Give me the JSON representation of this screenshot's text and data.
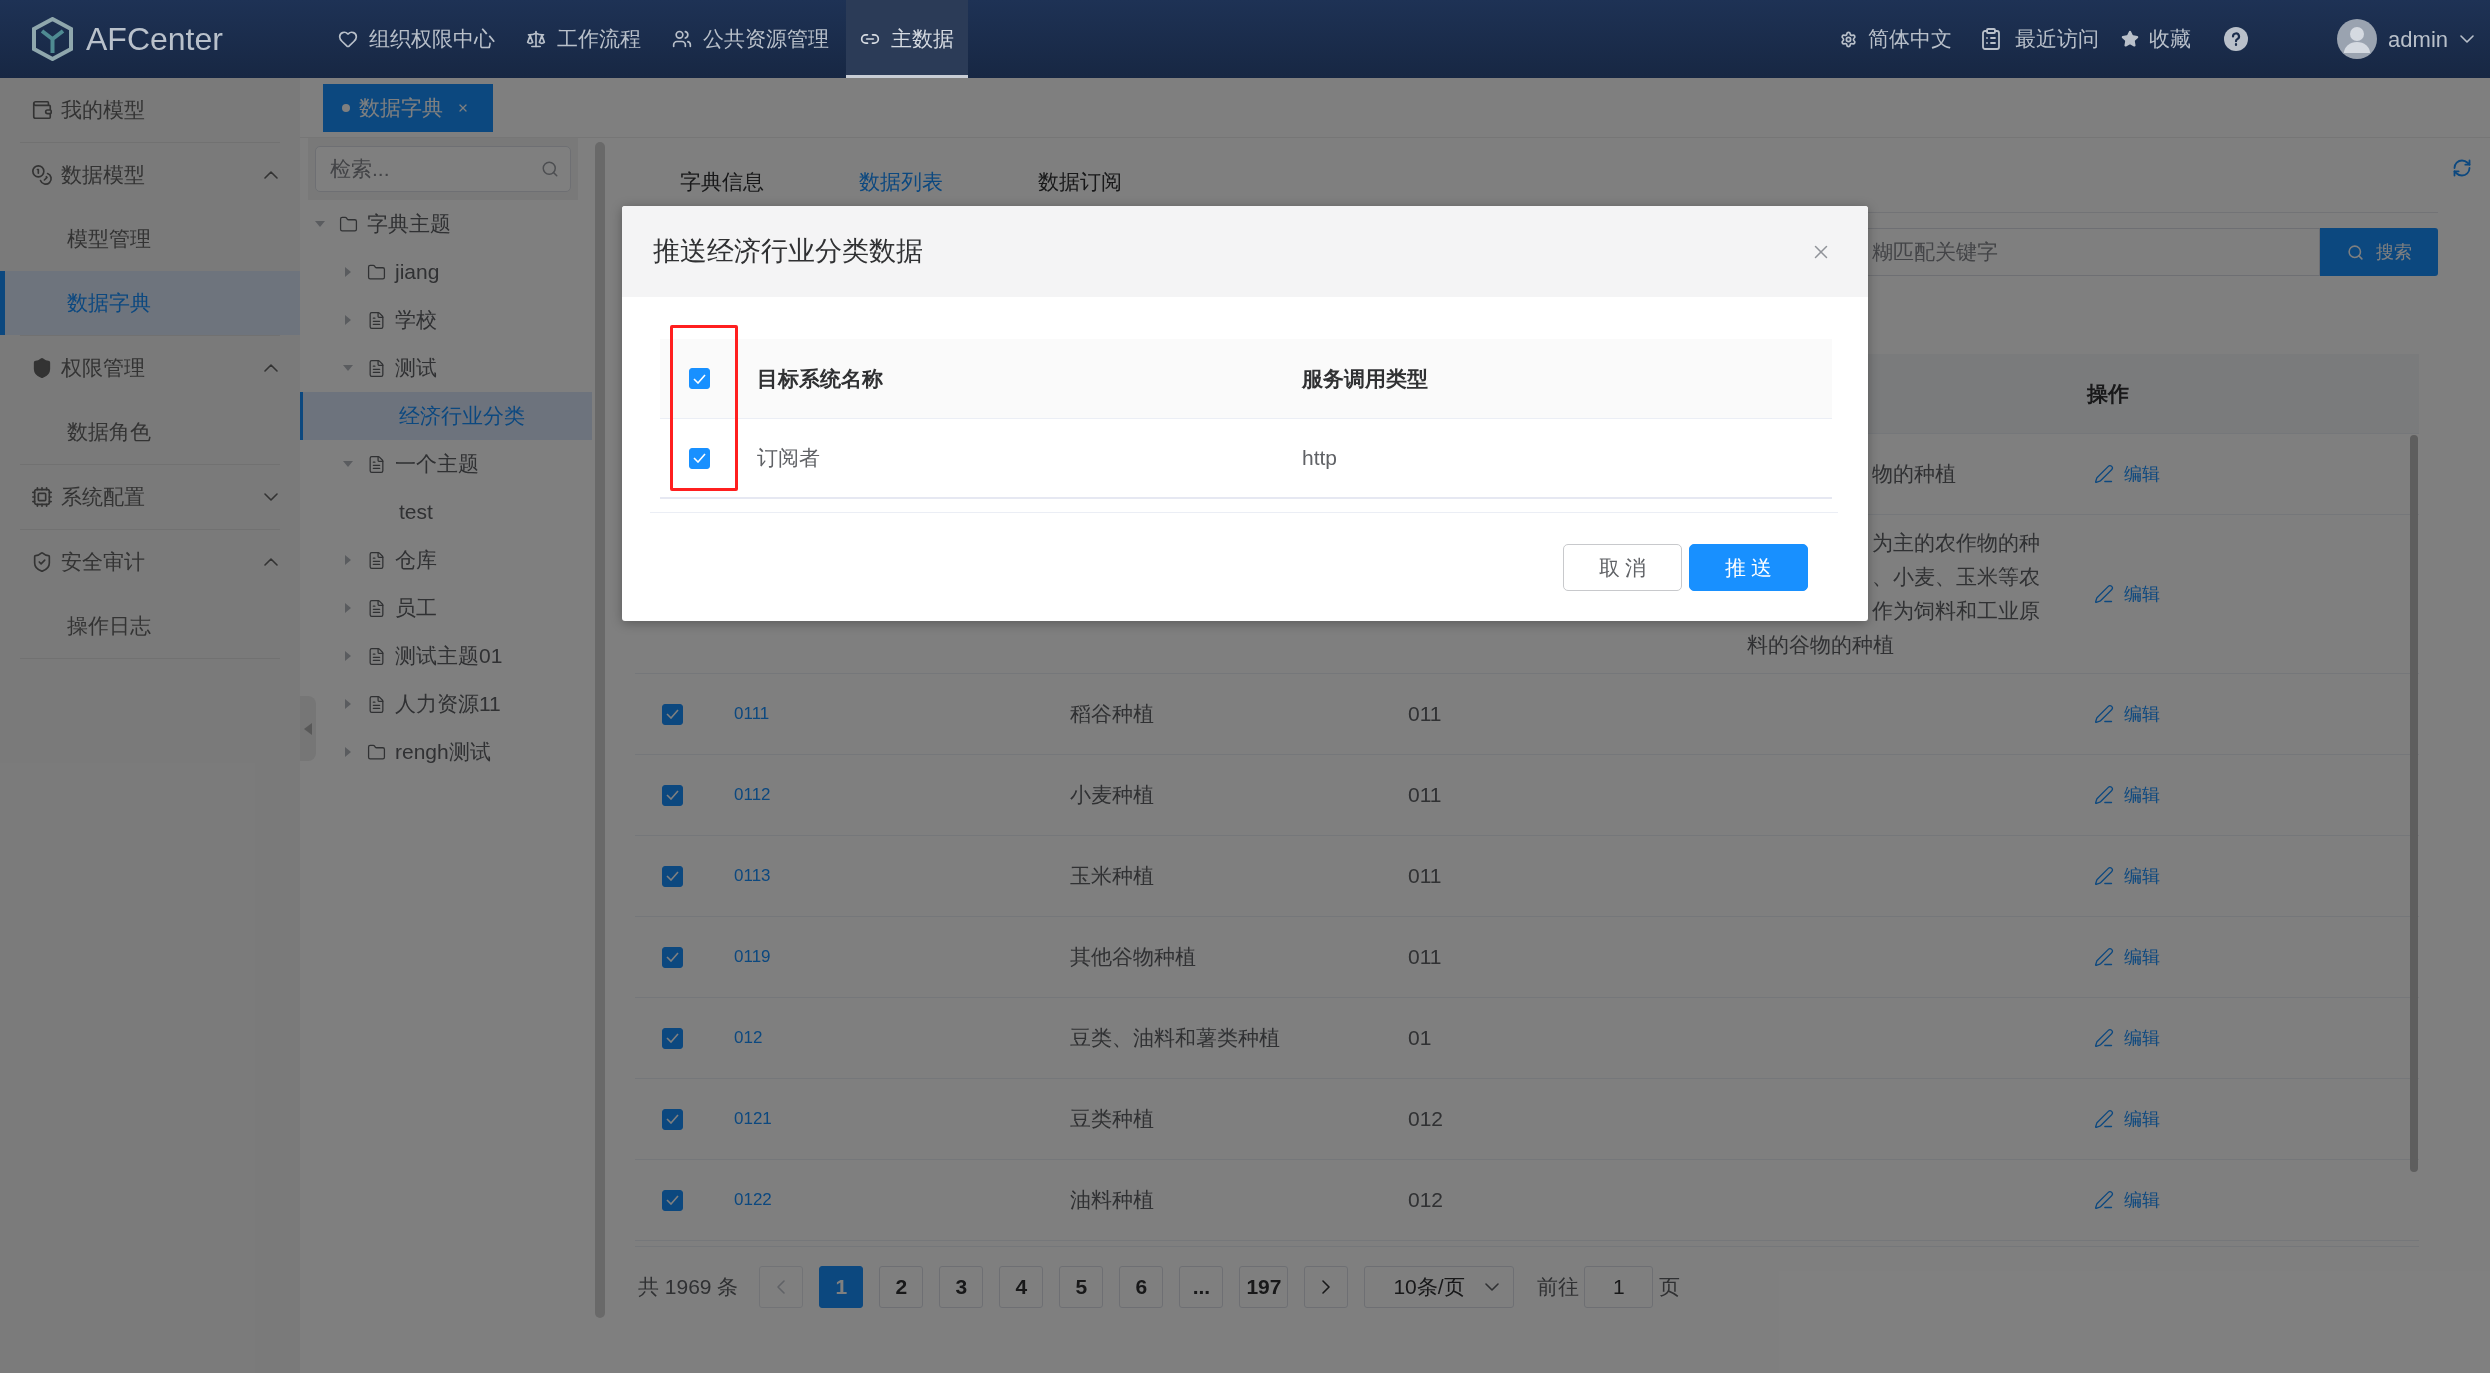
{
  "header": {
    "logo": "AFCenter",
    "nav": [
      {
        "label": "组织权限中心",
        "selected": false
      },
      {
        "label": "工作流程",
        "selected": false
      },
      {
        "label": "公共资源管理",
        "selected": false
      },
      {
        "label": "主数据",
        "selected": true
      }
    ],
    "language": "简体中文",
    "recent": "最近访问",
    "favorites": "收藏",
    "user": "admin"
  },
  "sidebar": {
    "items": [
      {
        "label": "我的模型",
        "selected": false
      },
      {
        "label": "数据模型",
        "expanded": true,
        "children": [
          {
            "label": "模型管理",
            "selected": false
          },
          {
            "label": "数据字典",
            "selected": true
          }
        ]
      },
      {
        "label": "权限管理",
        "expanded": true,
        "children": [
          {
            "label": "数据角色",
            "selected": false
          }
        ]
      },
      {
        "label": "系统配置",
        "expanded": false
      },
      {
        "label": "安全审计",
        "expanded": true,
        "children": [
          {
            "label": "操作日志",
            "selected": false
          }
        ]
      }
    ]
  },
  "tag_bar": {
    "tags": [
      {
        "label": "数据字典",
        "selected": true
      }
    ]
  },
  "tree": {
    "search": {
      "placeholder": "检索..."
    },
    "nodes": [
      {
        "label": "字典主题",
        "kind": "folder",
        "expanded": true,
        "selected": false,
        "children": [
          {
            "label": "jiang",
            "kind": "folder",
            "expanded": false,
            "selected": false
          },
          {
            "label": "学校",
            "kind": "file",
            "expanded": false,
            "selected": false
          },
          {
            "label": "测试",
            "kind": "file",
            "expanded": true,
            "selected": false,
            "children": [
              {
                "label": "经济行业分类",
                "selected": true
              }
            ]
          },
          {
            "label": "一个主题",
            "kind": "file",
            "expanded": true,
            "selected": false,
            "children": [
              {
                "label": "test",
                "selected": false
              }
            ]
          },
          {
            "label": "仓库",
            "kind": "file",
            "expanded": false,
            "selected": false
          },
          {
            "label": "员工",
            "kind": "file",
            "expanded": false,
            "selected": false
          },
          {
            "label": "测试主题01",
            "kind": "file",
            "expanded": false,
            "selected": false
          },
          {
            "label": "人力资源11",
            "kind": "file",
            "expanded": false,
            "selected": false
          },
          {
            "label": "rengh测试",
            "kind": "folder",
            "expanded": false,
            "selected": false
          }
        ]
      }
    ]
  },
  "tabs": [
    {
      "label": "字典信息",
      "selected": false
    },
    {
      "label": "数据列表",
      "selected": true
    },
    {
      "label": "数据订阅",
      "selected": false
    }
  ],
  "search": {
    "placeholder": "糊匹配关键字",
    "button": "搜索"
  },
  "table": {
    "operation_header": "操作",
    "rows": [
      {
        "column_5": [
          "物的种植"
        ],
        "operation": "编辑"
      },
      {
        "column_5": [
          "为主的农作物的种",
          "、小麦、玉米等农",
          "作为饲料和工业原",
          "料的谷物的种植"
        ],
        "operation": "编辑"
      },
      {
        "checked": true,
        "column_2": "0111",
        "column_3": "稻谷种植",
        "column_4": "011",
        "operation": "编辑"
      },
      {
        "checked": true,
        "column_2": "0112",
        "column_3": "小麦种植",
        "column_4": "011",
        "operation": "编辑"
      },
      {
        "checked": true,
        "column_2": "0113",
        "column_3": "玉米种植",
        "column_4": "011",
        "operation": "编辑"
      },
      {
        "checked": true,
        "column_2": "0119",
        "column_3": "其他谷物种植",
        "column_4": "011",
        "operation": "编辑"
      },
      {
        "checked": true,
        "column_2": "012",
        "column_3": "豆类、油料和薯类种植",
        "column_4": "01",
        "operation": "编辑"
      },
      {
        "checked": true,
        "column_2": "0121",
        "column_3": "豆类种植",
        "column_4": "012",
        "operation": "编辑"
      },
      {
        "checked": true,
        "column_2": "0122",
        "column_3": "油料种植",
        "column_4": "012",
        "operation": "编辑"
      }
    ]
  },
  "pagination": {
    "total": "共 1969 条",
    "prev_disabled": true,
    "next_disabled": false,
    "pages": [
      {
        "label": "1",
        "selected": true
      },
      {
        "label": "2",
        "selected": false
      },
      {
        "label": "3",
        "selected": false
      },
      {
        "label": "4",
        "selected": false
      },
      {
        "label": "5",
        "selected": false
      },
      {
        "label": "6",
        "selected": false
      },
      {
        "label": "...",
        "selected": false
      },
      {
        "label": "197",
        "selected": false
      }
    ],
    "page_size": "10条/页",
    "goto_label": "前往",
    "goto_value": "1",
    "goto_unit": "页"
  },
  "dialog": {
    "title": "推送经济行业分类数据",
    "header_checked": true,
    "columns": [
      "目标系统名称",
      "服务调用类型"
    ],
    "rows": [
      {
        "checked": true,
        "cells": [
          "订阅者",
          "http"
        ]
      }
    ],
    "buttons": [
      {
        "label": "取 消",
        "kind": "secondary"
      },
      {
        "label": "推 送",
        "kind": "primary"
      }
    ]
  }
}
